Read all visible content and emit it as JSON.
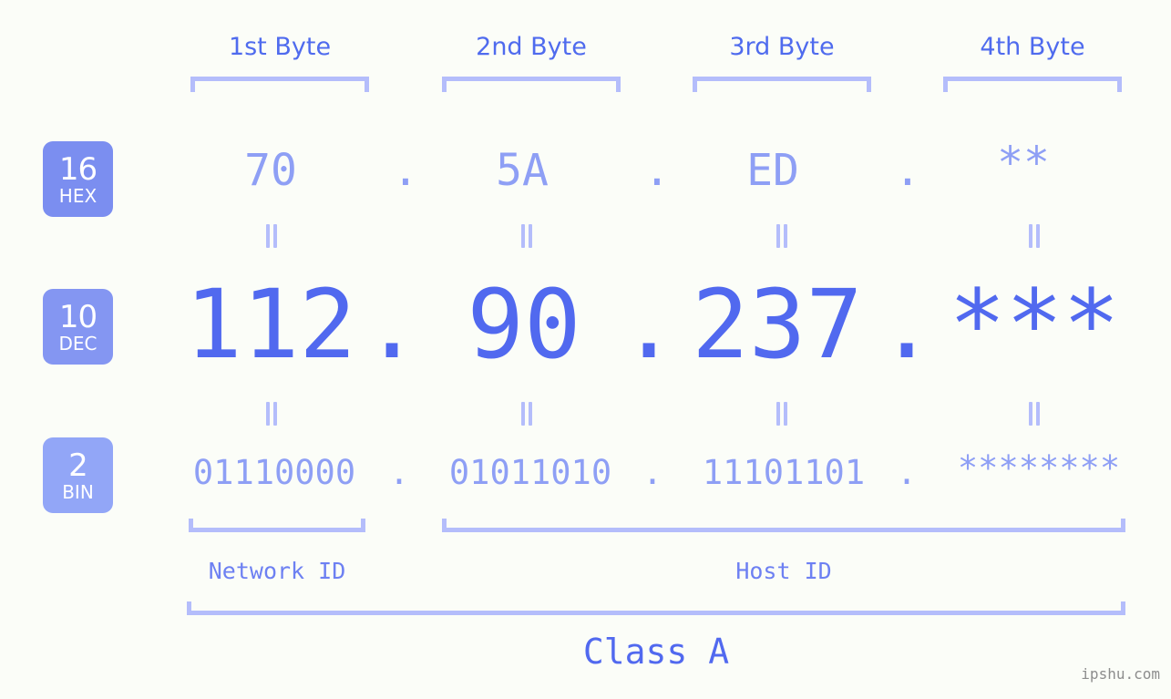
{
  "background_color": "#fbfdf8",
  "accent_colors": {
    "strong_blue": "#5169ef",
    "mid_blue": "#4f6bee",
    "light_blue": "#8e9ff5",
    "bracket": "#b4bdfb",
    "badge_hex": "#7b8ef0",
    "badge_dec": "#8496f2",
    "badge_bin": "#92a6f7",
    "watermark": "#8d8d8d"
  },
  "byte_headers": [
    {
      "label": "1st Byte"
    },
    {
      "label": "2nd Byte"
    },
    {
      "label": "3rd Byte"
    },
    {
      "label": "4th Byte"
    }
  ],
  "bases": [
    {
      "number": "16",
      "name": "HEX"
    },
    {
      "number": "10",
      "name": "DEC"
    },
    {
      "number": "2",
      "name": "BIN"
    }
  ],
  "rows": {
    "hex": {
      "b1": "70",
      "b2": "5A",
      "b3": "ED",
      "b4": "**",
      "sep": "."
    },
    "dec": {
      "b1": "112",
      "b2": "90",
      "b3": "237",
      "b4": "***",
      "sep": "."
    },
    "bin": {
      "b1": "01110000",
      "b2": "01011010",
      "b3": "11101101",
      "b4": "********",
      "sep": "."
    }
  },
  "segments": {
    "network_id": "Network ID",
    "host_id": "Host ID",
    "class": "Class A"
  },
  "watermark": "ipshu.com"
}
